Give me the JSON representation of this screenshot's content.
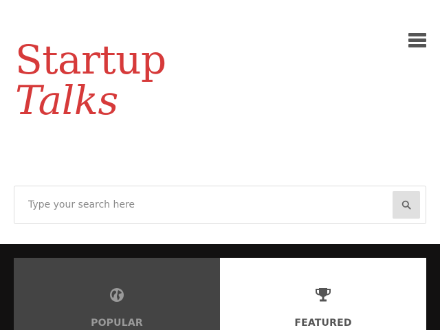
{
  "logo": {
    "line1": "Startup",
    "line2": "Talks"
  },
  "menu": {
    "icon": "hamburger-menu-icon"
  },
  "search": {
    "placeholder": "Type your search here",
    "value": "",
    "button_icon": "search-icon"
  },
  "tabs": [
    {
      "label": "POPULAR",
      "icon": "globe-icon",
      "active": true
    },
    {
      "label": "FEATURED",
      "icon": "trophy-icon",
      "active": false
    }
  ],
  "colors": {
    "brand": "#d63a3a",
    "dark_band": "#121111",
    "active_tab": "#444444"
  }
}
